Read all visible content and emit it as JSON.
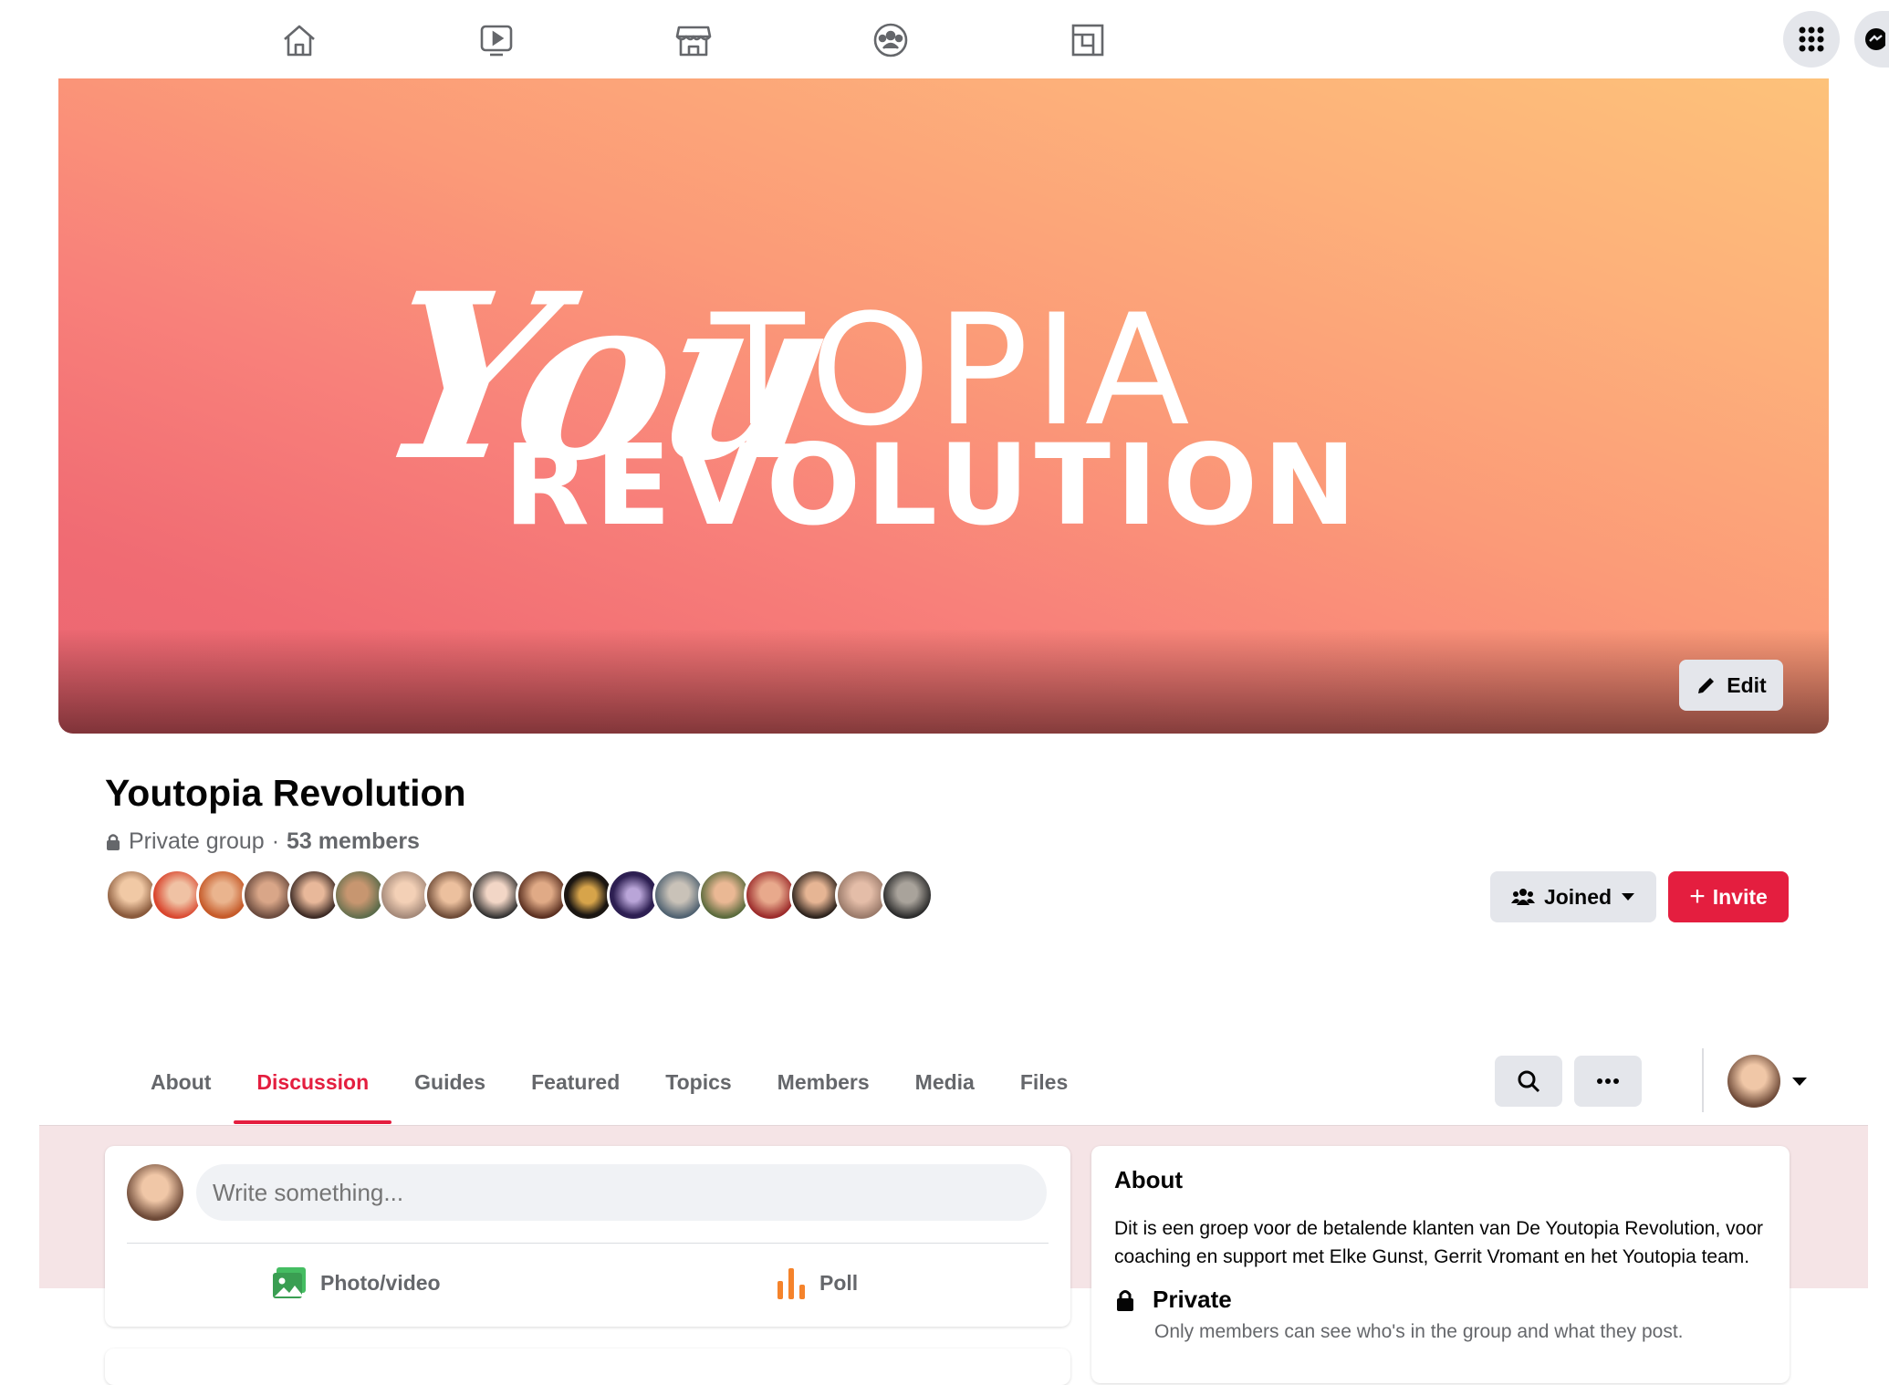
{
  "nav": {
    "icons": [
      "home-icon",
      "watch-icon",
      "marketplace-icon",
      "groups-icon",
      "gaming-icon"
    ],
    "right_icons": [
      "menu-grid-icon",
      "messenger-icon"
    ]
  },
  "cover": {
    "logo_script": "You",
    "logo_topia": "TOPIA",
    "logo_revolution": "REVOLUTION",
    "edit_label": "Edit"
  },
  "group": {
    "title": "Youtopia Revolution",
    "privacy": "Private group",
    "separator": "·",
    "members": "53 members",
    "member_avatar_count": 18,
    "joined_label": "Joined",
    "invite_label": "Invite"
  },
  "tabs": [
    {
      "label": "About",
      "active": false
    },
    {
      "label": "Discussion",
      "active": true
    },
    {
      "label": "Guides",
      "active": false
    },
    {
      "label": "Featured",
      "active": false
    },
    {
      "label": "Topics",
      "active": false
    },
    {
      "label": "Members",
      "active": false
    },
    {
      "label": "Media",
      "active": false
    },
    {
      "label": "Files",
      "active": false
    }
  ],
  "composer": {
    "placeholder": "Write something...",
    "photo_label": "Photo/video",
    "poll_label": "Poll"
  },
  "about": {
    "heading": "About",
    "description": "Dit is een groep voor de betalende klanten van De Youtopia Revolution, voor coaching en support met Elke Gunst, Gerrit Vromant en het Youtopia team.",
    "privacy_title": "Private",
    "privacy_desc": "Only members can see who's in the group and what they post."
  },
  "colors": {
    "accent": "#e41e3f",
    "button_gray": "#e4e6eb",
    "feed_bg": "#f5e4e6",
    "text_secondary": "#65676b"
  }
}
